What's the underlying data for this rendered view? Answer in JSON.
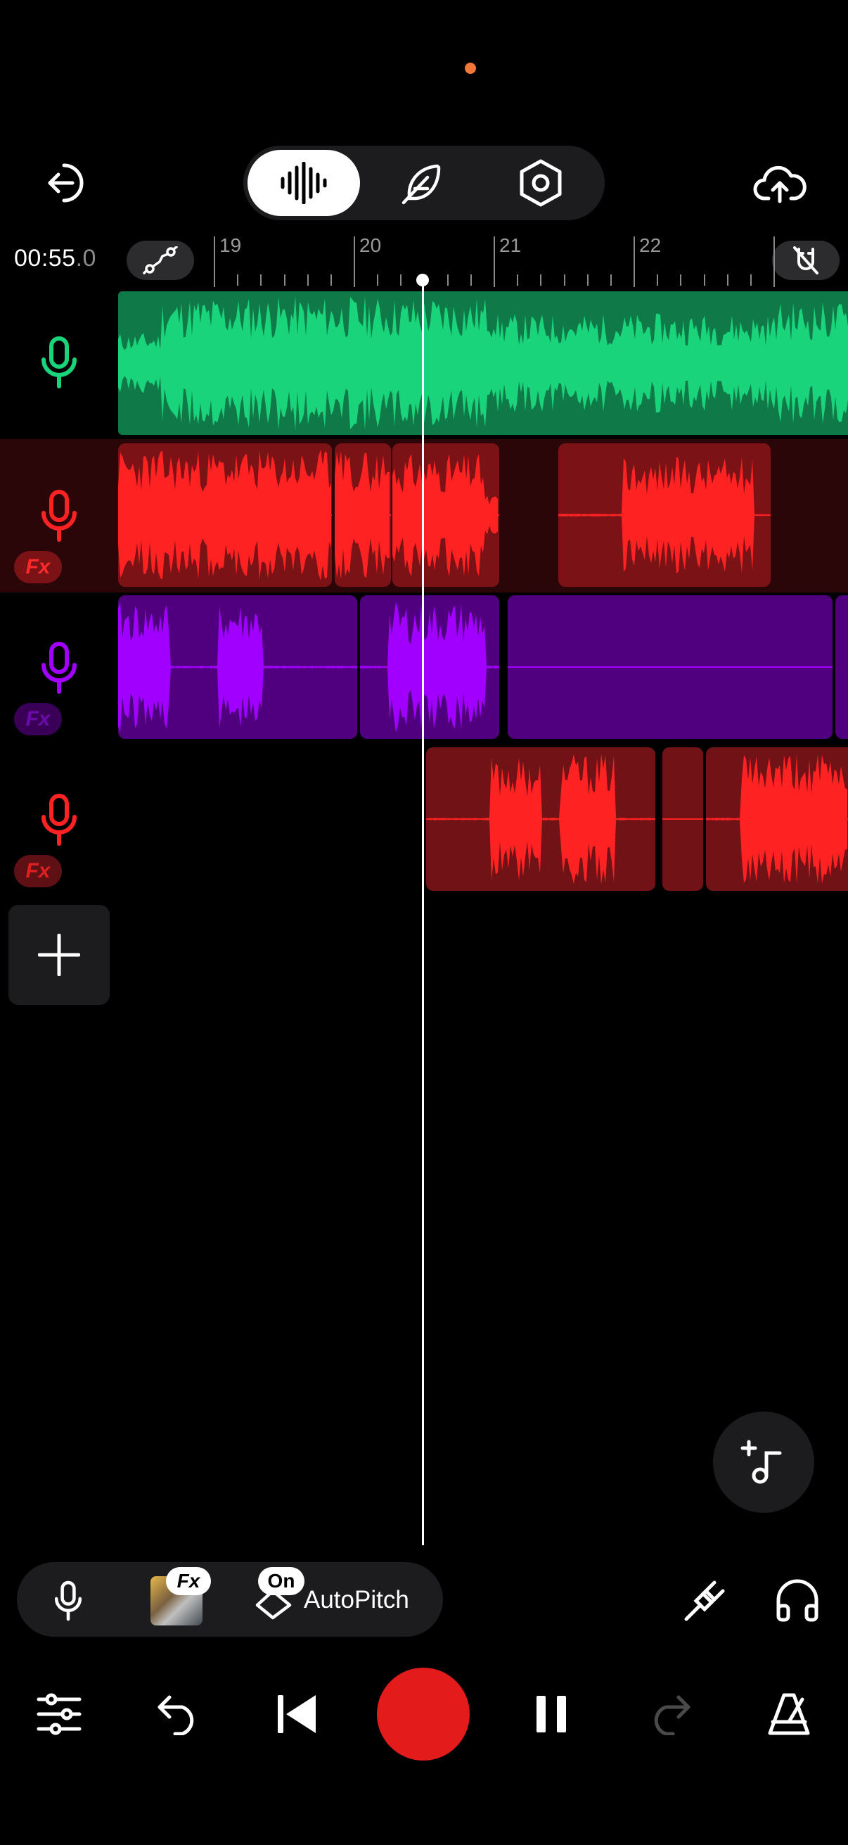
{
  "status": {
    "indicator_color": "#f2783a"
  },
  "header": {
    "exit_icon": "exit-icon",
    "modes": [
      {
        "name": "waveform-mode",
        "icon": "waveform-icon",
        "active": true
      },
      {
        "name": "feather-mode",
        "icon": "feather-icon",
        "active": false
      },
      {
        "name": "settings-mode",
        "icon": "hex-nut-icon",
        "active": false
      }
    ],
    "upload_icon": "cloud-upload-icon"
  },
  "timeline": {
    "time_main": "00:55",
    "time_frac": ".0",
    "ruler_labels": [
      "19",
      "20",
      "21",
      "22"
    ],
    "left_icon": "automation-curve-icon",
    "right_icon": "magnet-off-icon"
  },
  "tracks": [
    {
      "color": "#19d47a",
      "dark": "#0f7a48",
      "has_fx": false
    },
    {
      "color": "#ff2222",
      "dark": "#7a1216",
      "has_fx": true,
      "fx_label": "Fx",
      "selected": true
    },
    {
      "color": "#a100ff",
      "dark": "#50007e",
      "has_fx": true,
      "fx_label": "Fx"
    },
    {
      "color": "#ff2222",
      "dark": "#701216",
      "has_fx": true,
      "fx_label": "Fx"
    }
  ],
  "bottom_bar": {
    "fx_badge": "Fx",
    "on_badge": "On",
    "autopitch_label": "AutoPitch"
  },
  "transport": {
    "record_color": "#e31b1b"
  }
}
